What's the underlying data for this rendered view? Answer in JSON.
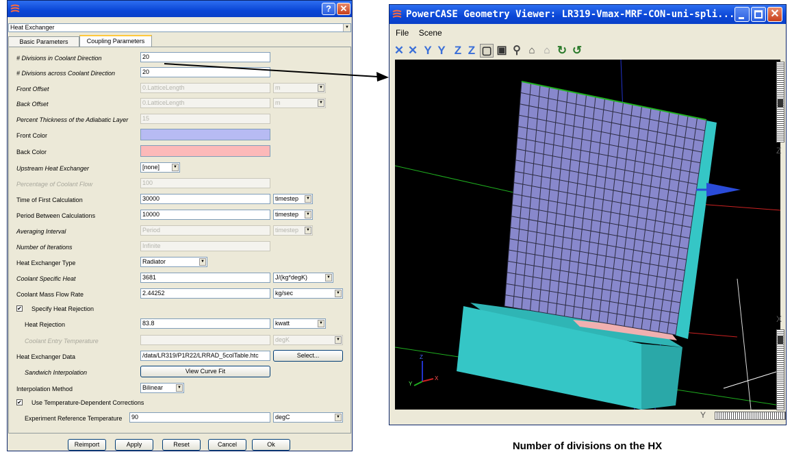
{
  "dialog": {
    "selector_value": "Heat Exchanger",
    "tabs": [
      "Basic Parameters",
      "Coupling Parameters"
    ],
    "rows": {
      "div_coolant": {
        "label": "# Divisions in Coolant Direction",
        "value": "20"
      },
      "div_across": {
        "label": "# Divisions across Coolant Direction",
        "value": "20"
      },
      "front_offset": {
        "label": "Front Offset",
        "value": "0.LatticeLength",
        "unit": "m"
      },
      "back_offset": {
        "label": "Back Offset",
        "value": "0.LatticeLength",
        "unit": "m"
      },
      "pct_thickness": {
        "label": "Percent Thickness of the Adiabatic Layer",
        "value": "15"
      },
      "front_color": {
        "label": "Front Color",
        "color": "#b7bbf3"
      },
      "back_color": {
        "label": "Back Color",
        "color": "#fcb9b9"
      },
      "upstream": {
        "label": "Upstream Heat Exchanger",
        "value": "[none]"
      },
      "pct_coolant": {
        "label": "Percentage of Coolant Flow",
        "value": "100"
      },
      "time_first": {
        "label": "Time of First Calculation",
        "value": "30000",
        "unit": "timestep"
      },
      "period_between": {
        "label": "Period Between Calculations",
        "value": "10000",
        "unit": "timestep"
      },
      "averaging": {
        "label": "Averaging Interval",
        "value": "Period",
        "unit": "timestep"
      },
      "iterations": {
        "label": "Number of Iterations",
        "value": "Infinite"
      },
      "hx_type": {
        "label": "Heat Exchanger Type",
        "value": "Radiator"
      },
      "specific_heat": {
        "label": "Coolant Specific Heat",
        "value": "3681",
        "unit": "J/(kg*degK)"
      },
      "mass_flow": {
        "label": "Coolant Mass Flow Rate",
        "value": "2.44252",
        "unit": "kg/sec"
      },
      "specify_rejection": {
        "label": "Specify Heat Rejection",
        "checked": "✔"
      },
      "heat_rejection": {
        "label": "Heat Rejection",
        "value": "83.8",
        "unit": "kwatt"
      },
      "entry_temp": {
        "label": "Coolant Entry Temperature",
        "value": "",
        "unit": "degK"
      },
      "hx_data": {
        "label": "Heat Exchanger Data",
        "value": "/data/LR319/P1R22/LRRAD_5colTable.htc",
        "button": "Select..."
      },
      "sandwich": {
        "label": "Sandwich Interpolation",
        "button": "View Curve Fit"
      },
      "interp": {
        "label": "Interpolation Method",
        "value": "Bilinear"
      },
      "temp_corr": {
        "label": "Use Temperature-Dependent Corrections",
        "checked": "✔"
      },
      "exp_ref_temp": {
        "label": "Experiment Reference Temperature",
        "value": "90",
        "unit": "degC"
      }
    },
    "buttons": [
      "Reimport",
      "Apply",
      "Reset",
      "Cancel",
      "Ok"
    ]
  },
  "viewer": {
    "title": "PowerCASE Geometry Viewer: LR319-Vmax-MRF-CON-uni-spli...",
    "menu": [
      "File",
      "Scene"
    ],
    "axis_labels": {
      "z": "Z",
      "x": "X",
      "y": "Y"
    }
  },
  "caption": "Number of divisions on the HX",
  "colors": {
    "front": "#8888cc",
    "grid": "#2b2b40",
    "cyan": "#33cccc",
    "titlebar": "#0a46d6"
  }
}
